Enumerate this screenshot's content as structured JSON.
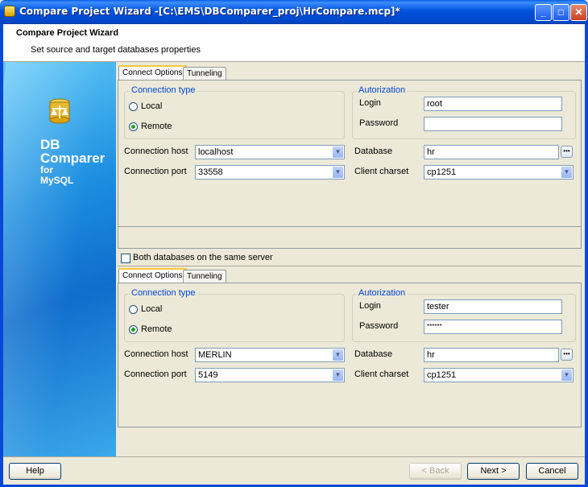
{
  "window": {
    "title": "Compare Project Wizard -[C:\\EMS\\DBComparer_proj\\HrCompare.mcp]*",
    "minimize": "_",
    "maximize": "□",
    "close": "✕"
  },
  "header": {
    "title": "Compare Project Wizard",
    "subtitle": "Set source and target databases properties"
  },
  "side": {
    "brand_line1": "DB",
    "brand_line2": "Comparer",
    "brand_line3": "for",
    "brand_line4": "MySQL"
  },
  "source": {
    "tabs": [
      "Connect Options",
      "Tunneling"
    ],
    "connection_type_legend": "Connection type",
    "local_label": "Local",
    "remote_label": "Remote",
    "selected": "Remote",
    "authorization_legend": "Autorization",
    "login_label": "Login",
    "login_value": "root",
    "password_label": "Password",
    "password_value": "",
    "host_label": "Connection host",
    "host_value": "localhost",
    "port_label": "Connection port",
    "port_value": "33558",
    "database_label": "Database",
    "database_value": "hr",
    "charset_label": "Client charset",
    "charset_value": "cp1251"
  },
  "same_server_label": "Both databases on the same server",
  "same_server_checked": false,
  "target": {
    "tabs": [
      "Connect Options",
      "Tunneling"
    ],
    "connection_type_legend": "Connection type",
    "local_label": "Local",
    "remote_label": "Remote",
    "selected": "Remote",
    "authorization_legend": "Autorization",
    "login_label": "Login",
    "login_value": "tester",
    "password_label": "Password",
    "password_value": "******",
    "host_label": "Connection host",
    "host_value": "MERLIN",
    "port_label": "Connection port",
    "port_value": "5149",
    "database_label": "Database",
    "database_value": "hr",
    "charset_label": "Client charset",
    "charset_value": "cp1251"
  },
  "footer": {
    "help": "Help",
    "back": "< Back",
    "next": "Next >",
    "cancel": "Cancel"
  },
  "colors": {
    "titlebar": "#0052de",
    "accent_legend": "#0046d5",
    "radio_selected": "#21a121"
  },
  "icons": [
    "app-icon",
    "database-scales-icon",
    "chevron-down-icon",
    "ellipsis-icon"
  ]
}
